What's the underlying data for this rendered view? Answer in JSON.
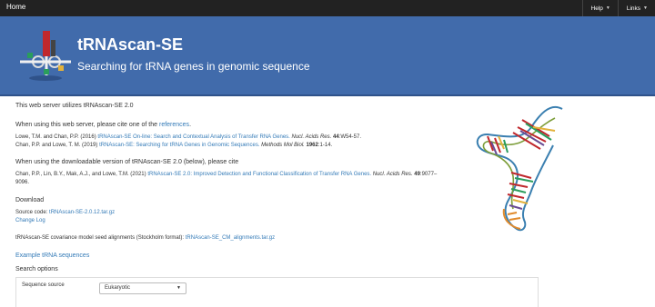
{
  "nav": {
    "home": "Home",
    "help": "Help",
    "links": "Links"
  },
  "banner": {
    "title": "tRNAscan-SE",
    "subtitle": "Searching for tRNA genes in genomic sequence"
  },
  "intro": "This web server utilizes tRNAscan-SE 2.0",
  "cite_web": {
    "prefix": "When using this web server, please cite one of the ",
    "link": "references",
    "suffix": "."
  },
  "refs_web": [
    {
      "authors": "Lowe, T.M. and Chan, P.P. (2016) ",
      "title": "tRNAscan-SE On-line: Search and Contextual Analysis of Transfer RNA Genes.",
      "journal": " Nucl. Acids Res.",
      "volume": " 44",
      "pages": ":W54-57."
    },
    {
      "authors": "Chan, P.P. and Lowe, T. M. (2019) ",
      "title": "tRNAscan-SE: Searching for tRNA Genes in Genomic Sequences.",
      "journal": " Methods Mol Biol.",
      "volume": " 1962",
      "pages": ":1-14."
    }
  ],
  "cite_download": "When using the downloadable version of tRNAscan-SE 2.0 (below), please cite",
  "ref_download": {
    "authors": "Chan, P.P., Lin, B.Y., Mak, A.J., and Lowe, T.M. (2021) ",
    "title": "tRNAscan-SE 2.0: Improved Detection and Functional Classification of Transfer RNA Genes.",
    "journal": " Nucl. Acids Res.",
    "volume": " 49",
    "pages": ":9077–",
    "pages_cont": "9096."
  },
  "download": {
    "heading": "Download",
    "source_label": "Source code: ",
    "source_link": "tRNAscan-SE-2.0.12.tar.gz",
    "changelog": "Change Log",
    "cm_label": "tRNAscan-SE covariance model seed alignments (Stockholm format): ",
    "cm_link": "tRNAscan-SE_CM_alignments.tar.gz"
  },
  "example_link": "Example tRNA sequences",
  "search_options": {
    "heading": "Search options",
    "sequence_source_label": "Sequence source",
    "sequence_source_value": "Eukaryotic"
  },
  "colors": {
    "navbar": "#222222",
    "banner": "#416bab",
    "link": "#337ab7"
  }
}
